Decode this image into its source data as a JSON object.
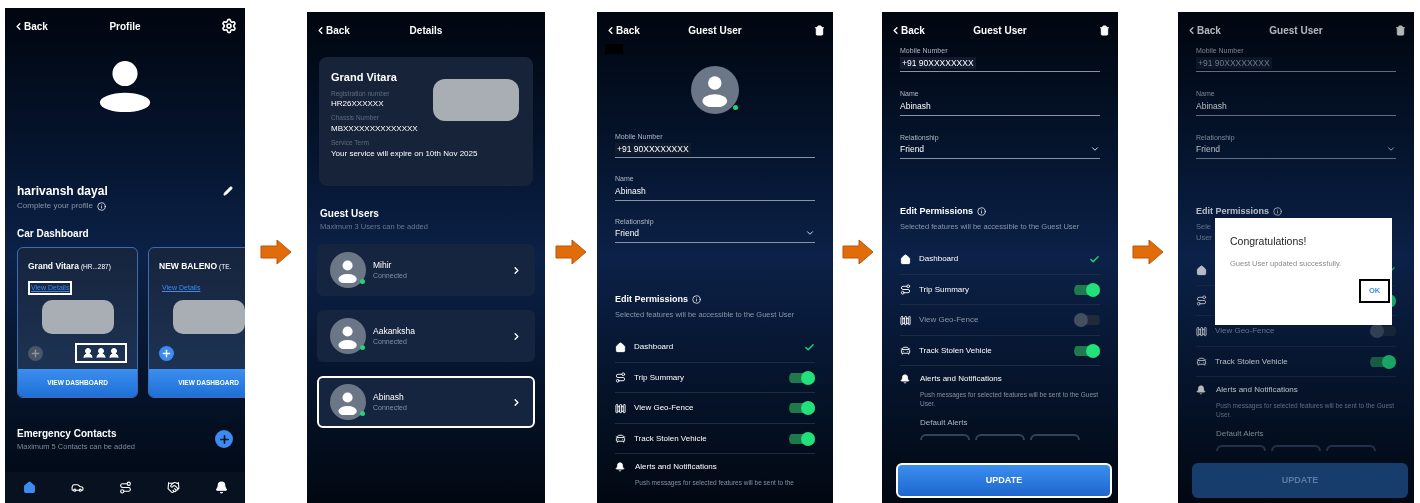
{
  "screens": [
    {
      "kind": "profile",
      "back": "Back",
      "title": "Profile",
      "user_name": "harivansh dayal",
      "profile_hint": "Complete your profile",
      "section": "Car Dashboard",
      "cars": [
        {
          "name": "Grand Vitara",
          "plate": "(HR...287)",
          "link": "View Details",
          "link_highlighted": true,
          "add_enabled": false,
          "has_guests": true,
          "guests_highlighted": true,
          "button": "VIEW DASHBOARD"
        },
        {
          "name": "NEW BALENO",
          "plate": "(TE.",
          "link": "View Details",
          "link_highlighted": false,
          "add_enabled": true,
          "has_guests": false,
          "button": "VIEW DASHBOARD"
        }
      ],
      "emergency_title": "Emergency Contacts",
      "emergency_hint": "Maximum 5 Contacts can be added",
      "nav": [
        {
          "kind": "home",
          "selected": true
        },
        {
          "kind": "driver",
          "selected": false
        },
        {
          "kind": "route",
          "selected": false
        },
        {
          "kind": "handshake",
          "selected": false
        },
        {
          "kind": "bell",
          "selected": false
        }
      ]
    },
    {
      "kind": "details",
      "back": "Back",
      "title": "Details",
      "car_name": "Grand Vitara",
      "car_fields": [
        {
          "label": "Registration number",
          "value": "HR26XXXXXX"
        },
        {
          "label": "Chassis Number",
          "value": "MBXXXXXXXXXXXXXX"
        },
        {
          "label": "Service Term",
          "value": "Your service will expire on 10th Nov 2025"
        }
      ],
      "guests_title": "Guest Users",
      "guests_hint": "Maximum 3 Users can be added",
      "guests": [
        {
          "name": "Mihir",
          "status": "Connected",
          "highlighted": false
        },
        {
          "name": "Aakanksha",
          "status": "Connected",
          "highlighted": false
        },
        {
          "name": "Abinash",
          "status": "Connected",
          "highlighted": true
        }
      ]
    },
    {
      "kind": "guest_form",
      "back": "Back",
      "title": "Guest User",
      "redacted": true,
      "show_avatar": true,
      "fields": [
        {
          "kind": "text",
          "label": "Mobile Number",
          "value": "+91 90XXXXXXXX",
          "disabled": false
        },
        {
          "kind": "text",
          "label": "Name",
          "value": "Abinash",
          "disabled": false
        },
        {
          "kind": "select",
          "label": "Relationship",
          "value": "Friend",
          "disabled": false
        }
      ],
      "permissions_title": "Edit Permissions",
      "permissions_hint": "Selected features will be accessible to the Guest User",
      "permissions": [
        {
          "kind": "check",
          "label": "Dashboard",
          "on": true
        },
        {
          "kind": "toggle",
          "label": "Trip Summary",
          "on": true
        },
        {
          "kind": "toggle",
          "label": "View Geo-Fence",
          "on": true
        },
        {
          "kind": "toggle",
          "label": "Track Stolen Vehicle",
          "on": true
        },
        {
          "kind": "section",
          "label": "Alerts and Notifications",
          "note": "Push messages for selected features will be sent to the"
        }
      ]
    },
    {
      "kind": "guest_form",
      "back": "Back",
      "title": "Guest User",
      "fields": [
        {
          "kind": "text",
          "label": "Mobile Number",
          "value": "+91 90XXXXXXXX",
          "disabled": false
        },
        {
          "kind": "text",
          "label": "Name",
          "value": "Abinash",
          "disabled": false
        },
        {
          "kind": "select",
          "label": "Relationship",
          "value": "Friend",
          "disabled": false
        }
      ],
      "permissions_title": "Edit Permissions",
      "permissions_hint": "Selected features will be accessible to the Guest User",
      "permissions": [
        {
          "kind": "check",
          "label": "Dashboard",
          "on": true
        },
        {
          "kind": "toggle",
          "label": "Trip Summary",
          "on": true
        },
        {
          "kind": "toggle",
          "label": "View Geo-Fence",
          "on": false
        },
        {
          "kind": "toggle",
          "label": "Track Stolen Vehicle",
          "on": true
        },
        {
          "kind": "section",
          "label": "Alerts and Notifications",
          "note": "Push messages for selected features will be sent to the Guest User."
        }
      ],
      "default_alerts": "Default Alerts",
      "update": {
        "label": "UPDATE",
        "highlighted": true
      }
    },
    {
      "kind": "guest_form",
      "back": "Back",
      "title": "Guest User",
      "dimmed": true,
      "fields": [
        {
          "kind": "text",
          "label": "Mobile Number",
          "value": "+91 90XXXXXXXX",
          "disabled": true
        },
        {
          "kind": "text",
          "label": "Name",
          "value": "Abinash",
          "disabled": false
        },
        {
          "kind": "select",
          "label": "Relationship",
          "value": "Friend",
          "disabled": false
        }
      ],
      "permissions_title": "Edit Permissions",
      "permissions_hint_fragments": [
        "Sele",
        "User"
      ],
      "permissions": [
        {
          "kind": "check",
          "on": true
        },
        {
          "kind": "toggle",
          "on": true
        },
        {
          "kind": "toggle",
          "label": "View Geo-Fence",
          "on": false
        },
        {
          "kind": "toggle",
          "label": "Track Stolen Vehicle",
          "on": true
        },
        {
          "kind": "section",
          "label": "Alerts and Notifications",
          "note": "Push messages for selected features will be sent to the Guest User."
        }
      ],
      "default_alerts": "Default Alerts",
      "update": {
        "label": "UPDATE",
        "highlighted": false
      },
      "dialog": {
        "title": "Congratulations!",
        "message": "Guest User updated successfully.",
        "button": "OK",
        "button_highlighted": true
      }
    }
  ]
}
